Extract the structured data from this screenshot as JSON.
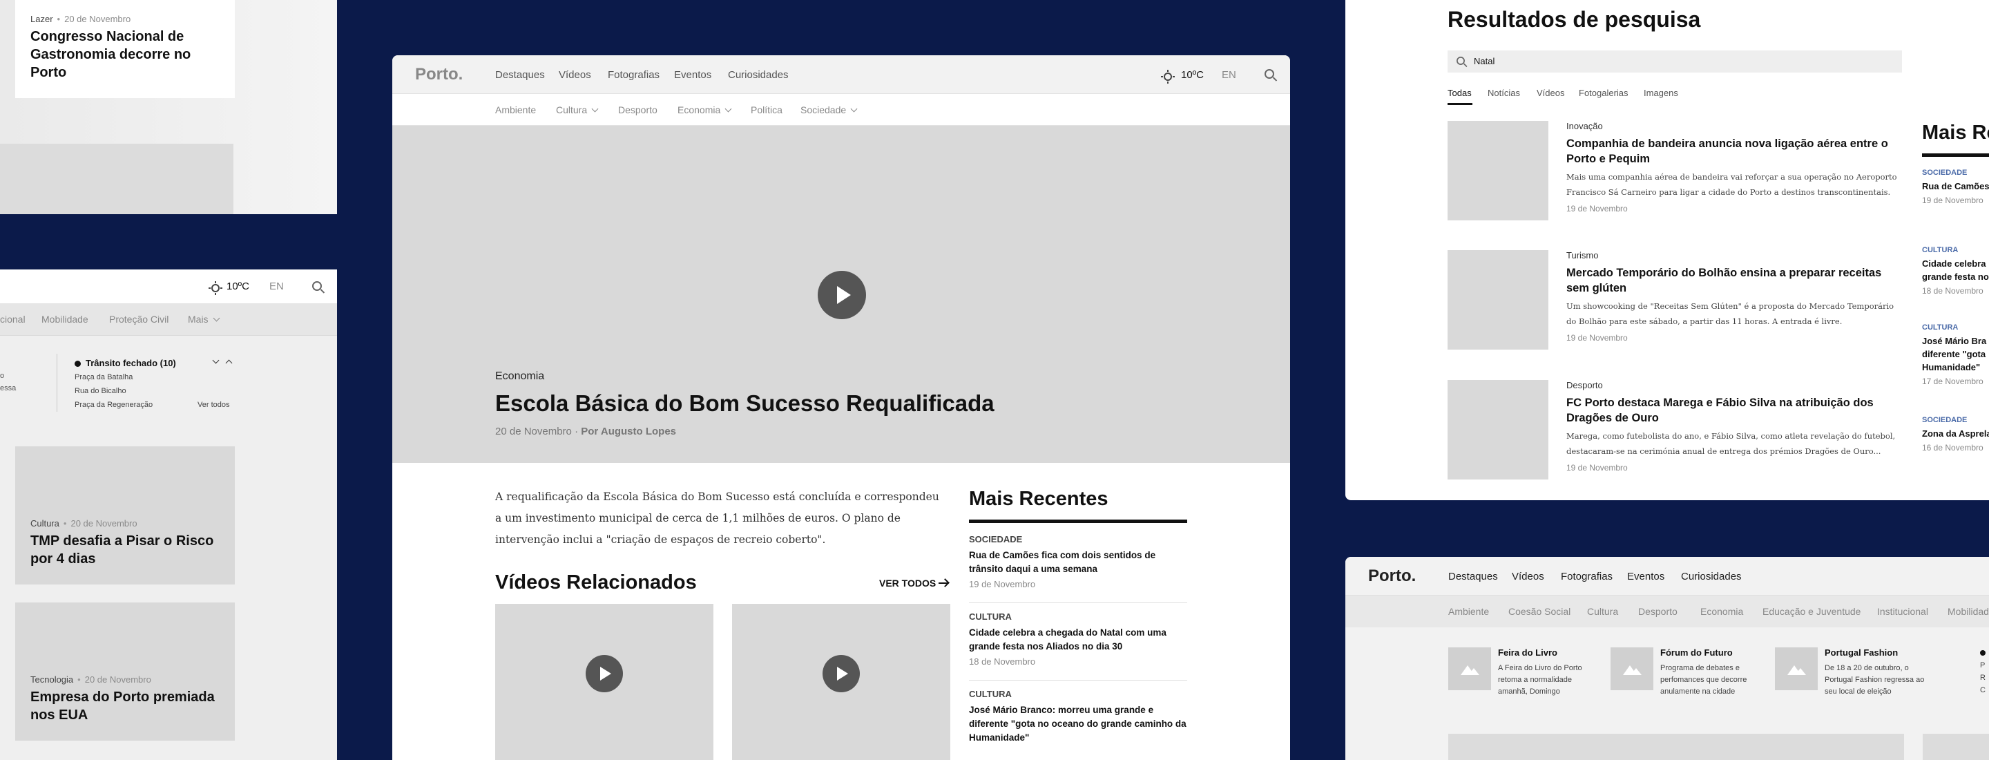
{
  "left_top": {
    "card": {
      "category": "Lazer",
      "date": "20 de Novembro",
      "title": "Congresso Nacional de Gastronomia decorre no Porto"
    }
  },
  "left_mid": {
    "weather": "10ºC",
    "lang": "EN",
    "subnav": [
      "cional",
      "Mobilidade",
      "Proteção Civil",
      "Mais"
    ],
    "traffic": {
      "title": "Trânsito fechado (10)",
      "items": [
        "Praça da Batalha",
        "Rua do Bicalho",
        "Praça da Regeneração"
      ],
      "see_all": "Ver todos",
      "left_fragments": [
        "o",
        "essa"
      ]
    },
    "cards": [
      {
        "category": "Cultura",
        "date": "20 de Novembro",
        "title": "TMP desafia a Pisar o Risco por 4 dias"
      },
      {
        "category": "Tecnologia",
        "date": "20 de Novembro",
        "title": "Empresa do Porto premiada nos EUA"
      }
    ]
  },
  "center": {
    "logo": "Porto.",
    "nav": [
      "Destaques",
      "Vídeos",
      "Fotografias",
      "Eventos",
      "Curiosidades"
    ],
    "weather": "10ºC",
    "lang": "EN",
    "subnav": [
      "Ambiente",
      "Cultura",
      "Desporto",
      "Economia",
      "Política",
      "Sociedade"
    ],
    "hero": {
      "category": "Economia",
      "title": "Escola Básica do Bom Sucesso Requalificada",
      "date": "20 de Novembro",
      "author": "Por Augusto Lopes"
    },
    "body": "A requalificação da Escola Básica do Bom Sucesso está concluída e correspondeu a um investimento municipal de cerca de 1,1 milhões de euros. O plano de intervenção inclui a \"criação de espaços de recreio coberto\".",
    "related_title": "Vídeos Relacionados",
    "see_all": "VER TODOS",
    "recent_title": "Mais Recentes",
    "recent": [
      {
        "category": "SOCIEDADE",
        "title": "Rua de Camões fica com dois sentidos de trânsito daqui a uma semana",
        "date": "19 de Novembro"
      },
      {
        "category": "CULTURA",
        "title": "Cidade celebra a chegada do Natal com uma grande festa nos Aliados no dia 30",
        "date": "18 de Novembro"
      },
      {
        "category": "CULTURA",
        "title": "José Mário Branco: morreu uma grande e diferente \"gota no oceano do grande caminho da Humanidade\"",
        "date": ""
      }
    ]
  },
  "right_top": {
    "title": "Resultados de pesquisa",
    "search_value": "Natal",
    "tabs": [
      "Todas",
      "Notícias",
      "Vídeos",
      "Fotogalerias",
      "Imagens"
    ],
    "results": [
      {
        "category": "Inovação",
        "title": "Companhia de bandeira anuncia nova ligação aérea entre o Porto e Pequim",
        "excerpt": "Mais uma companhia aérea de bandeira vai reforçar a sua operação no Aeroporto Francisco Sá Carneiro para ligar a cidade do Porto a destinos transcontinentais.",
        "date": "19 de Novembro"
      },
      {
        "category": "Turismo",
        "title": "Mercado Temporário do Bolhão ensina a preparar receitas sem glúten",
        "excerpt": "Um showcooking de \"Receitas Sem Glúten\" é a proposta do Mercado Temporário do Bolhão para este sábado, a partir das 11 horas. A entrada é livre.",
        "date": "19 de Novembro"
      },
      {
        "category": "Desporto",
        "title": "FC Porto destaca Marega e Fábio Silva na atribuição dos Dragões de Ouro",
        "excerpt": "Marega, como futebolista do ano, e Fábio Silva, como atleta revelação do futebol, destacaram-se na cerimónia anual de entrega dos prémios Dragões de Ouro...",
        "date": "19 de Novembro"
      }
    ],
    "side_title": "Mais Re",
    "side": [
      {
        "category": "SOCIEDADE",
        "title": "Rua de Camões daqui a uma se",
        "date": "19 de Novembro"
      },
      {
        "category": "CULTURA",
        "title": "Cidade celebra grande festa no",
        "date": "18 de Novembro"
      },
      {
        "category": "CULTURA",
        "title": "José Mário Bra diferente \"gota Humanidade\"",
        "date": "17 de Novembro"
      },
      {
        "category": "SOCIEDADE",
        "title": "Zona da Asprela",
        "date": "16 de Novembro"
      }
    ]
  },
  "right_bottom": {
    "logo": "Porto.",
    "nav": [
      "Destaques",
      "Vídeos",
      "Fotografias",
      "Eventos",
      "Curiosidades"
    ],
    "subnav": [
      "Ambiente",
      "Coesão Social",
      "Cultura",
      "Desporto",
      "Economia",
      "Educação e Juventude",
      "Institucional",
      "Mobilidad"
    ],
    "events": [
      {
        "title": "Feira do Livro",
        "desc": "A Feira do Livro do Porto retoma a normalidade amanhã, Domingo"
      },
      {
        "title": "Fórum do Futuro",
        "desc": "Programa de debates e perfomances que decorre anulamente na cidade"
      },
      {
        "title": "Portugal Fashion",
        "desc": "De 18 a 20 de outubro, o Portugal Fashion regressa ao seu local de eleição"
      }
    ],
    "edge_letters": [
      "P",
      "R",
      "C"
    ]
  }
}
